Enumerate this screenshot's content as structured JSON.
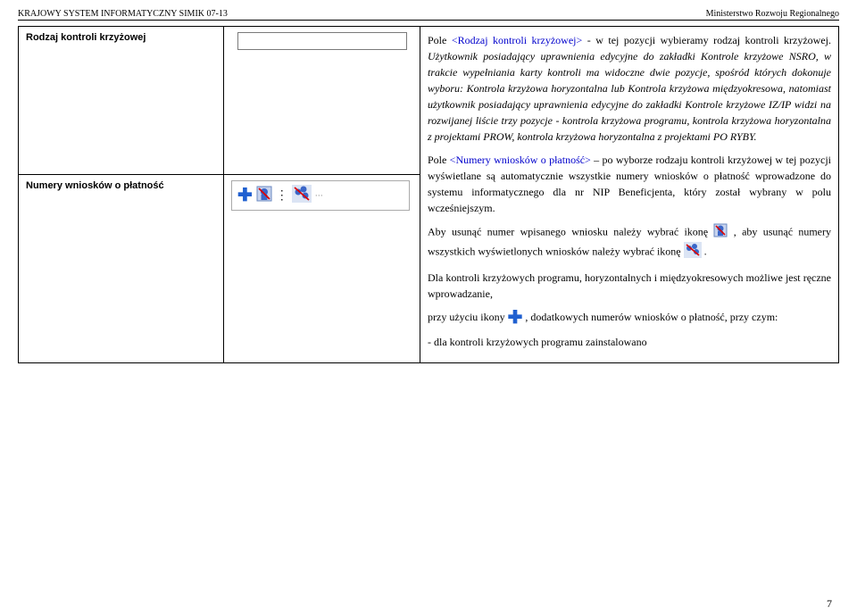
{
  "header": {
    "left": "KRAJOWY SYSTEM INFORMATYCZNY SIMIK 07-13",
    "right": "Ministerstwo Rozwoju Regionalnego"
  },
  "rows": [
    {
      "label": "Rodzaj kontroli krzyżowej",
      "desc_lead": "Pole ",
      "desc_tag": "<Rodzaj kontroli krzyżowej>",
      "desc_tail": " - w tej pozycji wybieramy rodzaj kontroli krzyżowej. ",
      "desc_italic": "Użytkownik posiadający uprawnienia edycyjne do zakładki Kontrole krzyżowe NSRO, w trakcie wypełniania karty kontroli ma widoczne dwie pozycje, spośród których dokonuje wyboru: Kontrola krzyżowa horyzontalna lub Kontrola krzyżowa międzyokresowa, natomiast użytkownik posiadający uprawnienia edycyjne do zakładki Kontrole krzyżowe IZ/IP widzi na rozwijanej liście trzy pozycje - kontrola krzyżowa programu, kontrola krzyżowa horyzontalna z projektami PROW, kontrola krzyżowa horyzontalna z projektami PO RYBY."
    },
    {
      "label": "Numery wniosków o płatność",
      "desc_lead": "Pole ",
      "desc_tag": "<Numery wniosków o płatność>",
      "desc_tail": " – po wyborze rodzaju kontroli krzyżowej w tej pozycji wyświetlane są automatycznie wszystkie numery wniosków o płatność wprowadzone do systemu informatycznego dla nr NIP Beneficjenta, który został wybrany w polu wcześniejszym."
    }
  ],
  "extra": {
    "p1a": "Aby usunąć numer wpisanego wniosku należy wybrać ikonę ",
    "p1b": ", aby usunąć numery wszystkich wyświetlonych wniosków należy wybrać ikonę ",
    "p1c": ".",
    "p2": "Dla kontroli krzyżowych programu, horyzontalnych i międzyokresowych możliwe jest ręczne wprowadzanie,",
    "p3a": "przy użyciu ikony ",
    "p3b": ", dodatkowych numerów wniosków o płatność, przy czym:",
    "p4": "- dla kontroli krzyżowych programu zainstalowano"
  },
  "page": "7"
}
